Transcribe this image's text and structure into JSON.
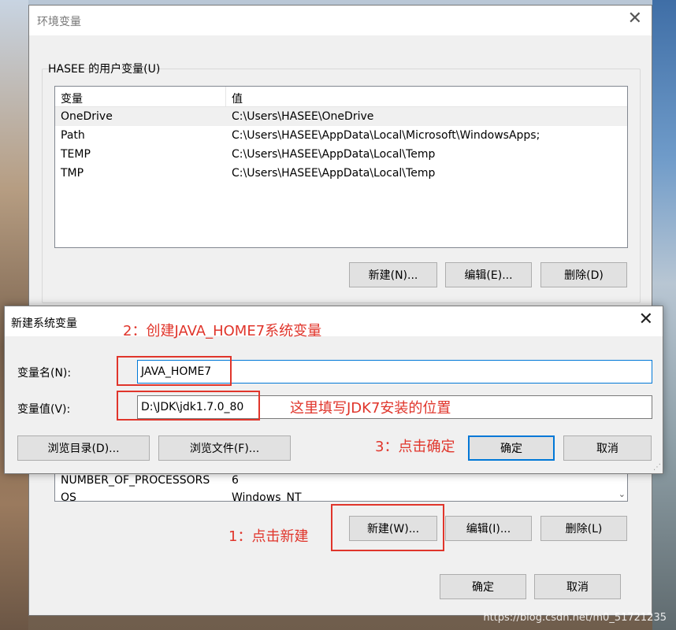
{
  "env_window": {
    "title": "环境变量",
    "close_glyph": "✕",
    "user_vars_label": "HASEE 的用户变量(U)",
    "columns": [
      "变量",
      "值"
    ],
    "user_vars": [
      {
        "name": "OneDrive",
        "value": "C:\\Users\\HASEE\\OneDrive"
      },
      {
        "name": "Path",
        "value": "C:\\Users\\HASEE\\AppData\\Local\\Microsoft\\WindowsApps;"
      },
      {
        "name": "TEMP",
        "value": "C:\\Users\\HASEE\\AppData\\Local\\Temp"
      },
      {
        "name": "TMP",
        "value": "C:\\Users\\HASEE\\AppData\\Local\\Temp"
      }
    ],
    "user_buttons": {
      "new": "新建(N)...",
      "edit": "编辑(E)...",
      "delete": "删除(D)"
    },
    "sys_vars": [
      {
        "name": "NUMBER_OF_PROCESSORS",
        "value": "6"
      },
      {
        "name": "OS",
        "value": "Windows_NT"
      }
    ],
    "sys_buttons": {
      "new": "新建(W)...",
      "edit": "编辑(I)...",
      "delete": "删除(L)"
    },
    "ok": "确定",
    "cancel": "取消"
  },
  "dialog": {
    "title": "新建系统变量",
    "close_glyph": "✕",
    "name_label": "变量名(N):",
    "name_value": "JAVA_HOME7",
    "value_label": "变量值(V):",
    "value_value": "D:\\JDK\\jdk1.7.0_80",
    "browse_dir": "浏览目录(D)...",
    "browse_file": "浏览文件(F)...",
    "ok": "确定",
    "cancel": "取消"
  },
  "annotations": {
    "step1": "1：点击新建",
    "step2": "2：创建JAVA_HOME7系统变量",
    "step3": "3：点击确定",
    "path_note": "这里填写JDK7安装的位置"
  },
  "watermark": "https://blog.csdn.net/m0_51721235",
  "colors": {
    "annotation_red": "#e0352b",
    "focus_blue": "#0078d7"
  }
}
